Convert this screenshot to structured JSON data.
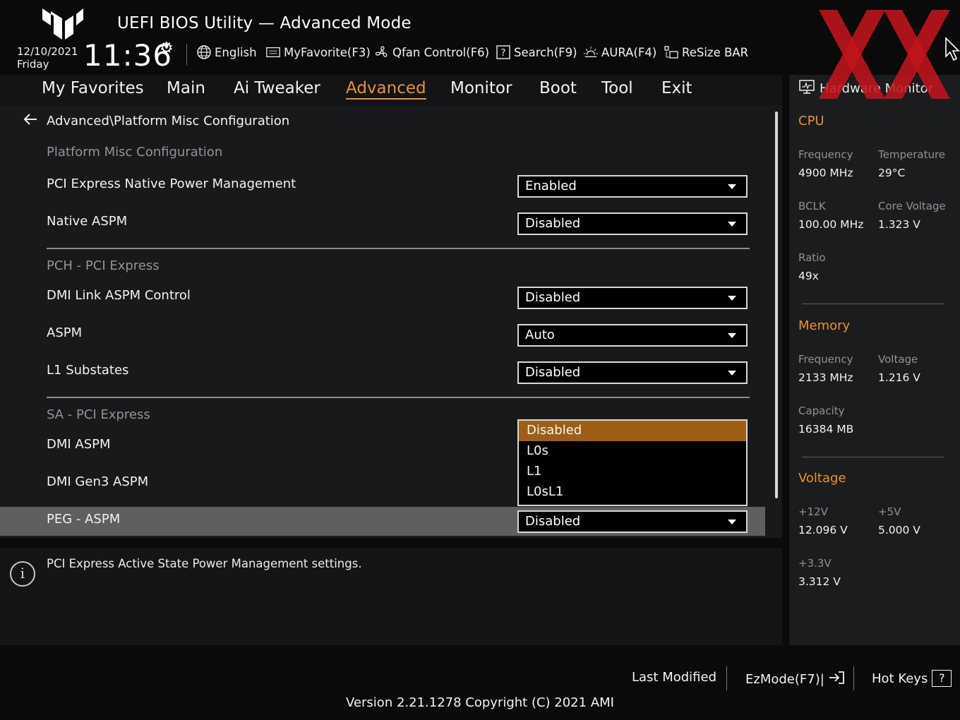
{
  "header": {
    "title": "UEFI BIOS Utility — Advanced Mode",
    "date": "12/10/2021",
    "day": "Friday",
    "time": "11:36",
    "tools": {
      "language": "English",
      "myfavorite": "MyFavorite(F3)",
      "qfan": "Qfan Control(F6)",
      "search": "Search(F9)",
      "aura": "AURA(F4)",
      "resize_bar": "ReSize BAR"
    }
  },
  "nav": {
    "tabs": [
      "My Favorites",
      "Main",
      "Ai Tweaker",
      "Advanced",
      "Monitor",
      "Boot",
      "Tool",
      "Exit"
    ],
    "active": "Advanced"
  },
  "breadcrumb": "Advanced\\Platform Misc Configuration",
  "sections": {
    "platform": "Platform Misc Configuration",
    "pch": "PCH - PCI Express",
    "sa": "SA - PCI Express"
  },
  "settings": [
    {
      "label": "PCI Express Native Power Management",
      "value": "Enabled"
    },
    {
      "label": "Native ASPM",
      "value": "Disabled"
    },
    {
      "label": "DMI Link ASPM Control",
      "value": "Disabled"
    },
    {
      "label": "ASPM",
      "value": "Auto"
    },
    {
      "label": "L1 Substates",
      "value": "Disabled"
    },
    {
      "label": "DMI ASPM",
      "value": ""
    },
    {
      "label": "DMI Gen3 ASPM",
      "value": ""
    },
    {
      "label": "PEG - ASPM",
      "value": "Disabled"
    }
  ],
  "dropdown": {
    "options": [
      "Disabled",
      "L0s",
      "L1",
      "L0sL1"
    ],
    "selected": "Disabled"
  },
  "help_text": "PCI Express Active State Power Management settings.",
  "hardware_monitor": {
    "title": "Hardware Monitor",
    "cpu": {
      "heading": "CPU",
      "frequency_label": "Frequency",
      "frequency": "4900 MHz",
      "temperature_label": "Temperature",
      "temperature": "29°C",
      "bclk_label": "BCLK",
      "bclk": "100.00 MHz",
      "core_voltage_label": "Core Voltage",
      "core_voltage": "1.323 V",
      "ratio_label": "Ratio",
      "ratio": "49x"
    },
    "memory": {
      "heading": "Memory",
      "frequency_label": "Frequency",
      "frequency": "2133 MHz",
      "voltage_label": "Voltage",
      "voltage": "1.216 V",
      "capacity_label": "Capacity",
      "capacity": "16384 MB"
    },
    "voltage": {
      "heading": "Voltage",
      "v12_label": "+12V",
      "v12": "12.096 V",
      "v5_label": "+5V",
      "v5": "5.000 V",
      "v33_label": "+3.3V",
      "v33": "3.312 V"
    }
  },
  "footer": {
    "last_modified": "Last Modified",
    "ezmode": "EzMode(F7)|",
    "hotkeys": "Hot Keys",
    "hotkeys_glyph": "?",
    "version": "Version 2.21.1278 Copyright (C) 2021 AMI"
  },
  "colors": {
    "accent": "#e8942a",
    "selected_option": "#9c5f15",
    "watermark": "#c0141c"
  }
}
